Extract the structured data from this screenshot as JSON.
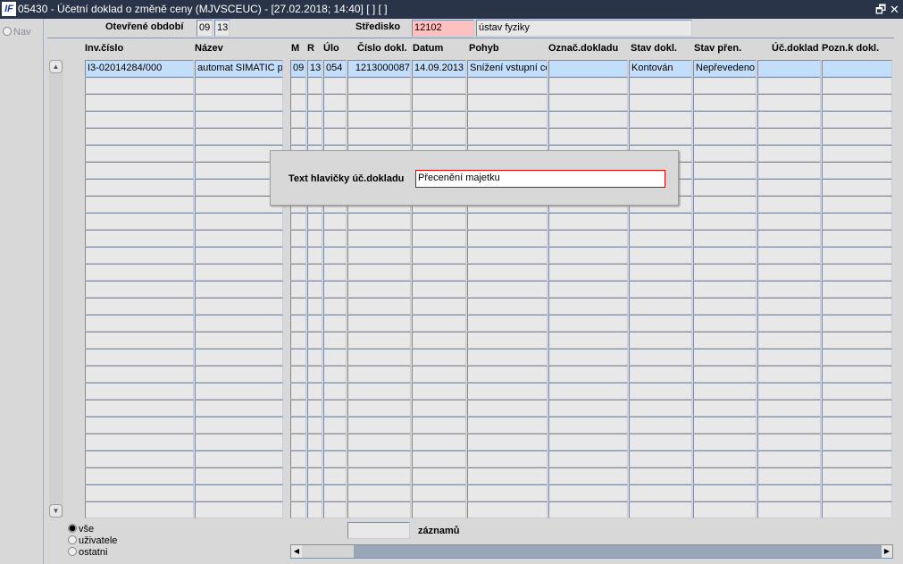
{
  "window": {
    "logo": "IF",
    "title": "05430 - Účetní doklad o změně ceny (MJVSCEUC) - [27.02.2018; 14:40]  [ ]  [ ]",
    "restore_icon": "restore-icon",
    "close_icon": "close-icon"
  },
  "nav": {
    "label": "Nav"
  },
  "header": {
    "period_label": "Otevřené období",
    "period_month": "09",
    "period_year": "13",
    "center_label": "Středisko",
    "center_code": "12102",
    "center_name": "ústav fyziky"
  },
  "columns": [
    "Inv.číslo",
    "Název",
    "M",
    "R",
    "Úlo",
    "Číslo dokl.",
    "Datum",
    "Pohyb",
    "Označ.dokladu",
    "Stav dokl.",
    "Stav přen.",
    "Úč.doklad",
    "Pozn.k dokl."
  ],
  "rows": [
    [
      "I3-02014284/000",
      "automat SIMATIC pr",
      "09",
      "13",
      "054",
      "1213000087",
      "14.09.2013",
      "Snížení vstupní ce",
      "",
      "Kontován",
      "Nepřevedeno",
      "",
      ""
    ]
  ],
  "dialog": {
    "label": "Text hlavičky úč.dokladu",
    "value": "Přecenění majetku"
  },
  "filter": {
    "options": [
      "vše",
      "uživatele",
      "ostatni"
    ],
    "selected": "vše"
  },
  "count": {
    "value": "",
    "label": "záznamů"
  }
}
